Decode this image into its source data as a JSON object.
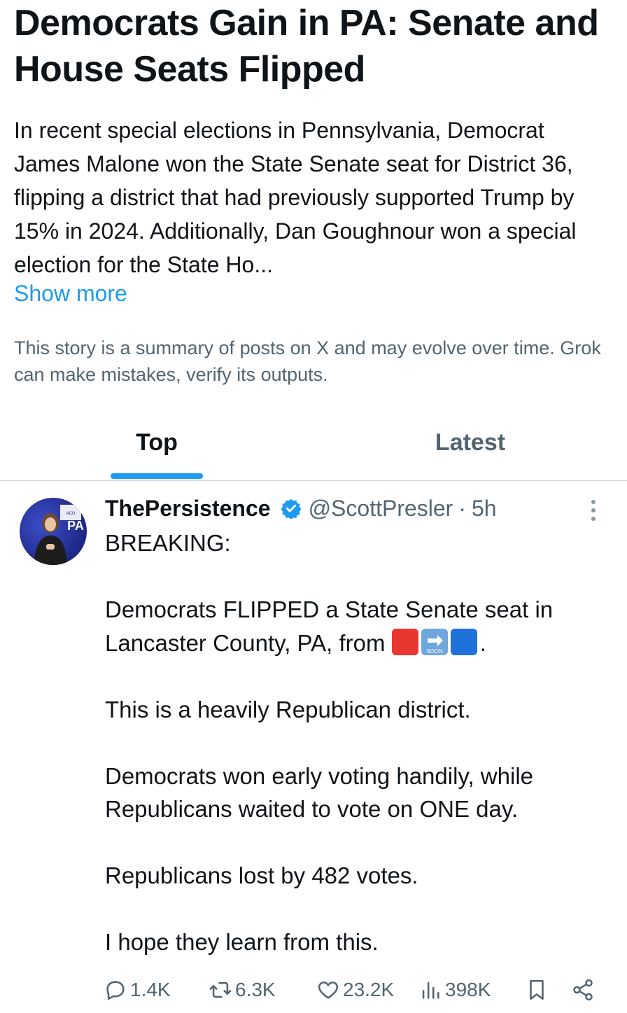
{
  "story": {
    "headline": "Democrats Gain in PA: Senate and House Seats Flipped",
    "summary": "In recent special elections in Pennsylvania, Democrat James Malone won the State Senate seat for District 36, flipping a district that had previously supported Trump by 15% in 2024. Additionally, Dan Goughnour won a special election for the State Ho...",
    "show_more": "Show more",
    "disclaimer": "This story is a summary of posts on X and may evolve over time. Grok can make mistakes, verify its outputs."
  },
  "tabs": [
    {
      "label": "Top",
      "active": true
    },
    {
      "label": "Latest",
      "active": false
    }
  ],
  "post": {
    "author_name": "ThePersistence",
    "handle": "@ScottPresler",
    "separator": "·",
    "time": "5h",
    "lines": {
      "l1": "BREAKING:",
      "l2_pre": "Democrats FLIPPED a State Senate seat in Lancaster County, PA, from ",
      "l2_post": ".",
      "l3": "This is a heavily Republican district.",
      "l4": "Democrats won early voting handily, while Republicans waited to vote on ONE day.",
      "l5": "Republicans lost by 482 votes.",
      "l6": "I hope they learn from this."
    },
    "emoji_soon_label": "SOON",
    "avatar_text": "AMERICAN CONSERVATIVE UNION"
  },
  "actions": {
    "replies": "1.4K",
    "reposts": "6.3K",
    "likes": "23.2K",
    "views": "398K"
  },
  "colors": {
    "accent": "#1d9bf0",
    "secondary_text": "#536471",
    "primary_text": "#0f1419"
  }
}
